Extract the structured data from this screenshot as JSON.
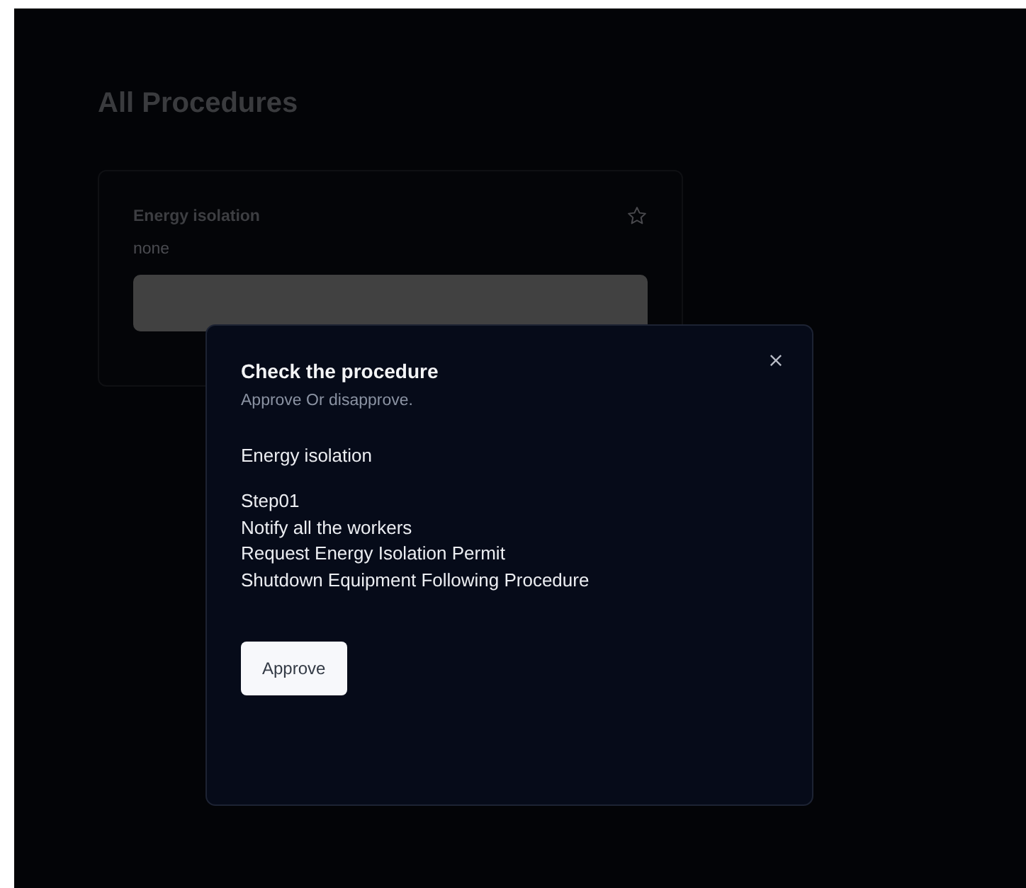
{
  "page": {
    "title": "All Procedures"
  },
  "procedures": [
    {
      "title": "Energy isolation",
      "description": "none"
    }
  ],
  "dialog": {
    "title": "Check the procedure",
    "subtitle": "Approve Or disapprove.",
    "procedure_name": "Energy isolation",
    "steps": [
      "Step01",
      "Notify all the workers",
      "Request Energy Isolation Permit",
      "Shutdown Equipment Following Procedure"
    ],
    "button": "Approve"
  }
}
